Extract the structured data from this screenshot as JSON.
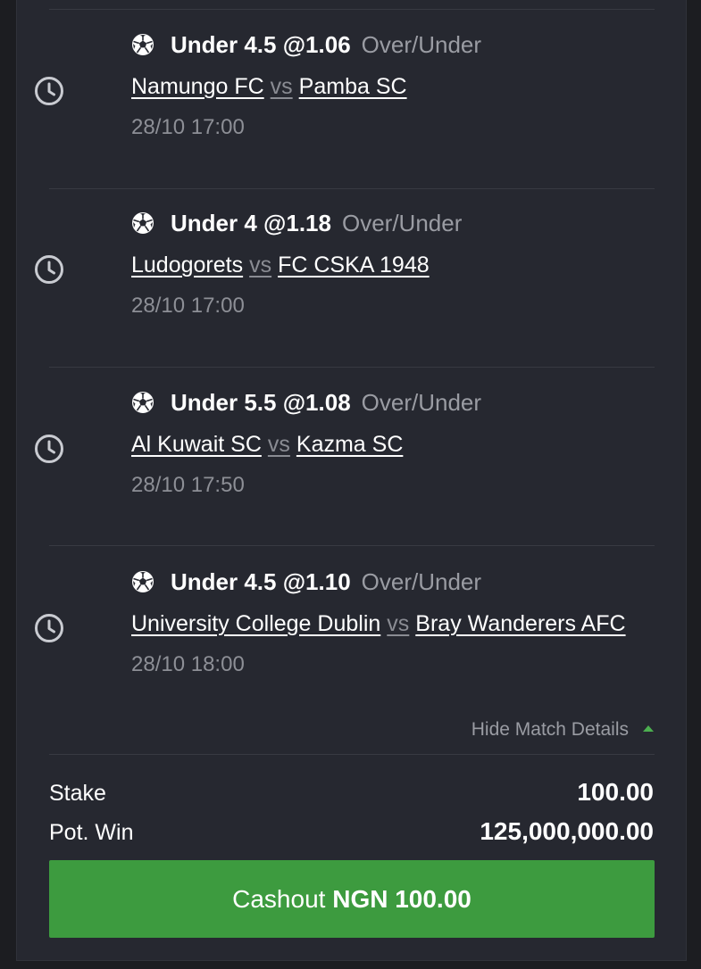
{
  "bets": [
    {
      "pick": "Under 4.5 @1.06",
      "market": "Over/Under",
      "home": "Namungo FC",
      "vs": "vs",
      "away": "Pamba SC",
      "kickoff": "28/10 17:00"
    },
    {
      "pick": "Under 4 @1.18",
      "market": "Over/Under",
      "home": "Ludogorets",
      "vs": "vs",
      "away": "FC CSKA 1948",
      "kickoff": "28/10 17:00"
    },
    {
      "pick": "Under 5.5 @1.08",
      "market": "Over/Under",
      "home": "Al Kuwait SC",
      "vs": "vs",
      "away": "Kazma SC",
      "kickoff": "28/10 17:50"
    },
    {
      "pick": "Under 4.5 @1.10",
      "market": "Over/Under",
      "home": "University College Dublin",
      "vs": "vs",
      "away": "Bray Wanderers AFC",
      "kickoff": "28/10 18:00"
    }
  ],
  "details_toggle": "Hide Match Details",
  "summary": {
    "stake_label": "Stake",
    "stake_value": "100.00",
    "potwin_label": "Pot. Win",
    "potwin_value": "125,000,000.00"
  },
  "cashout": {
    "label": "Cashout",
    "amount": "NGN 100.00"
  },
  "colors": {
    "background": "#262830",
    "accent_green": "#3d9b3f",
    "muted_text": "#9a9ca3"
  },
  "icons": {
    "sport": "soccer-ball-icon",
    "status": "clock-icon",
    "toggle": "caret-up-icon"
  }
}
